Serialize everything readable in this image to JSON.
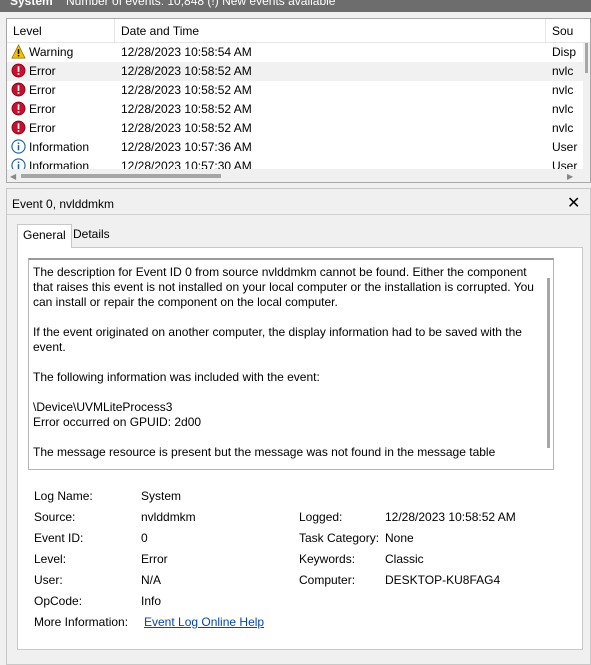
{
  "window": {
    "log_name_short": "System",
    "event_count_text": "Number of events: 10,848 (!) New events available"
  },
  "grid": {
    "columns": [
      "Level",
      "Date and Time",
      "Sou"
    ],
    "rows": [
      {
        "level": "Warning",
        "icon": "warning-icon",
        "datetime": "12/28/2023 10:58:54 AM",
        "source": "Disp"
      },
      {
        "level": "Error",
        "icon": "error-icon",
        "datetime": "12/28/2023 10:58:52 AM",
        "source": "nvlc"
      },
      {
        "level": "Error",
        "icon": "error-icon",
        "datetime": "12/28/2023 10:58:52 AM",
        "source": "nvlc"
      },
      {
        "level": "Error",
        "icon": "error-icon",
        "datetime": "12/28/2023 10:58:52 AM",
        "source": "nvlc"
      },
      {
        "level": "Error",
        "icon": "error-icon",
        "datetime": "12/28/2023 10:58:52 AM",
        "source": "nvlc"
      },
      {
        "level": "Information",
        "icon": "info-icon",
        "datetime": "12/28/2023 10:57:36 AM",
        "source": "User"
      },
      {
        "level": "Information",
        "icon": "info-icon",
        "datetime": "12/28/2023 10:57:30 AM",
        "source": "User"
      }
    ]
  },
  "detail": {
    "title": "Event 0, nvlddmkm",
    "close": "✕",
    "tabs": [
      "General",
      "Details"
    ],
    "description": [
      "The description for Event ID 0 from source nvlddmkm cannot be found. Either the component that raises this event is not installed on your local computer or the installation is corrupted. You can install or repair the component on the local computer.",
      "If the event originated on another computer, the display information had to be saved with the event.",
      "The following information was included with the event:",
      "\\Device\\UVMLiteProcess3\nError occurred on GPUID: 2d00",
      "The message resource is present but the message was not found in the message table"
    ],
    "fields": {
      "log_name_label": "Log Name:",
      "log_name": "System",
      "source_label": "Source:",
      "source": "nvlddmkm",
      "logged_label": "Logged:",
      "logged": "12/28/2023 10:58:52 AM",
      "event_id_label": "Event ID:",
      "event_id": "0",
      "task_category_label": "Task Category:",
      "task_category": "None",
      "level_label": "Level:",
      "level": "Error",
      "keywords_label": "Keywords:",
      "keywords": "Classic",
      "user_label": "User:",
      "user": "N/A",
      "computer_label": "Computer:",
      "computer": "DESKTOP-KU8FAG4",
      "opcode_label": "OpCode:",
      "opcode": "Info",
      "more_info_label": "More Information:",
      "more_info_link": "Event Log Online Help"
    }
  },
  "colors": {
    "warning": "#f2c200",
    "error": "#c8102e",
    "info": "#1f5fa8",
    "link": "#0645ad"
  }
}
